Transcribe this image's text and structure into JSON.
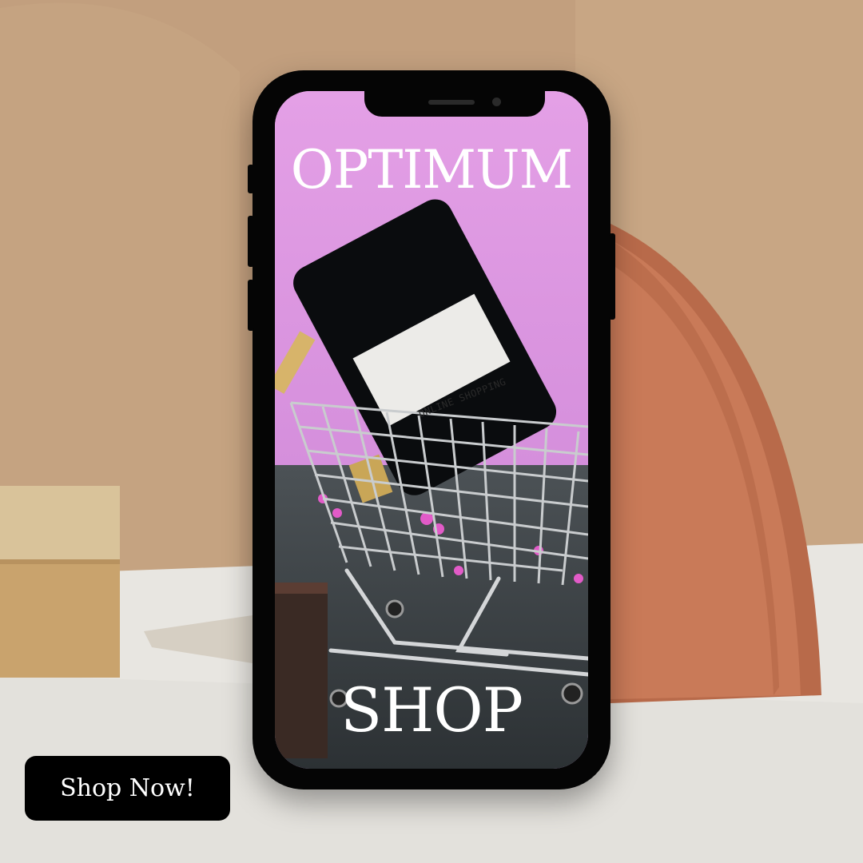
{
  "hero": {
    "title_top": "OPTIMUM",
    "title_bottom": "SHOP",
    "mock_screen_text": "ONLINE SHOPPING"
  },
  "cta": {
    "label": "Shop Now!"
  },
  "colors": {
    "background": "#c4a484",
    "phone_frame": "#050505",
    "screen_pink": "#d98be0",
    "cta_background": "#000000",
    "cta_text": "#ffffff"
  }
}
